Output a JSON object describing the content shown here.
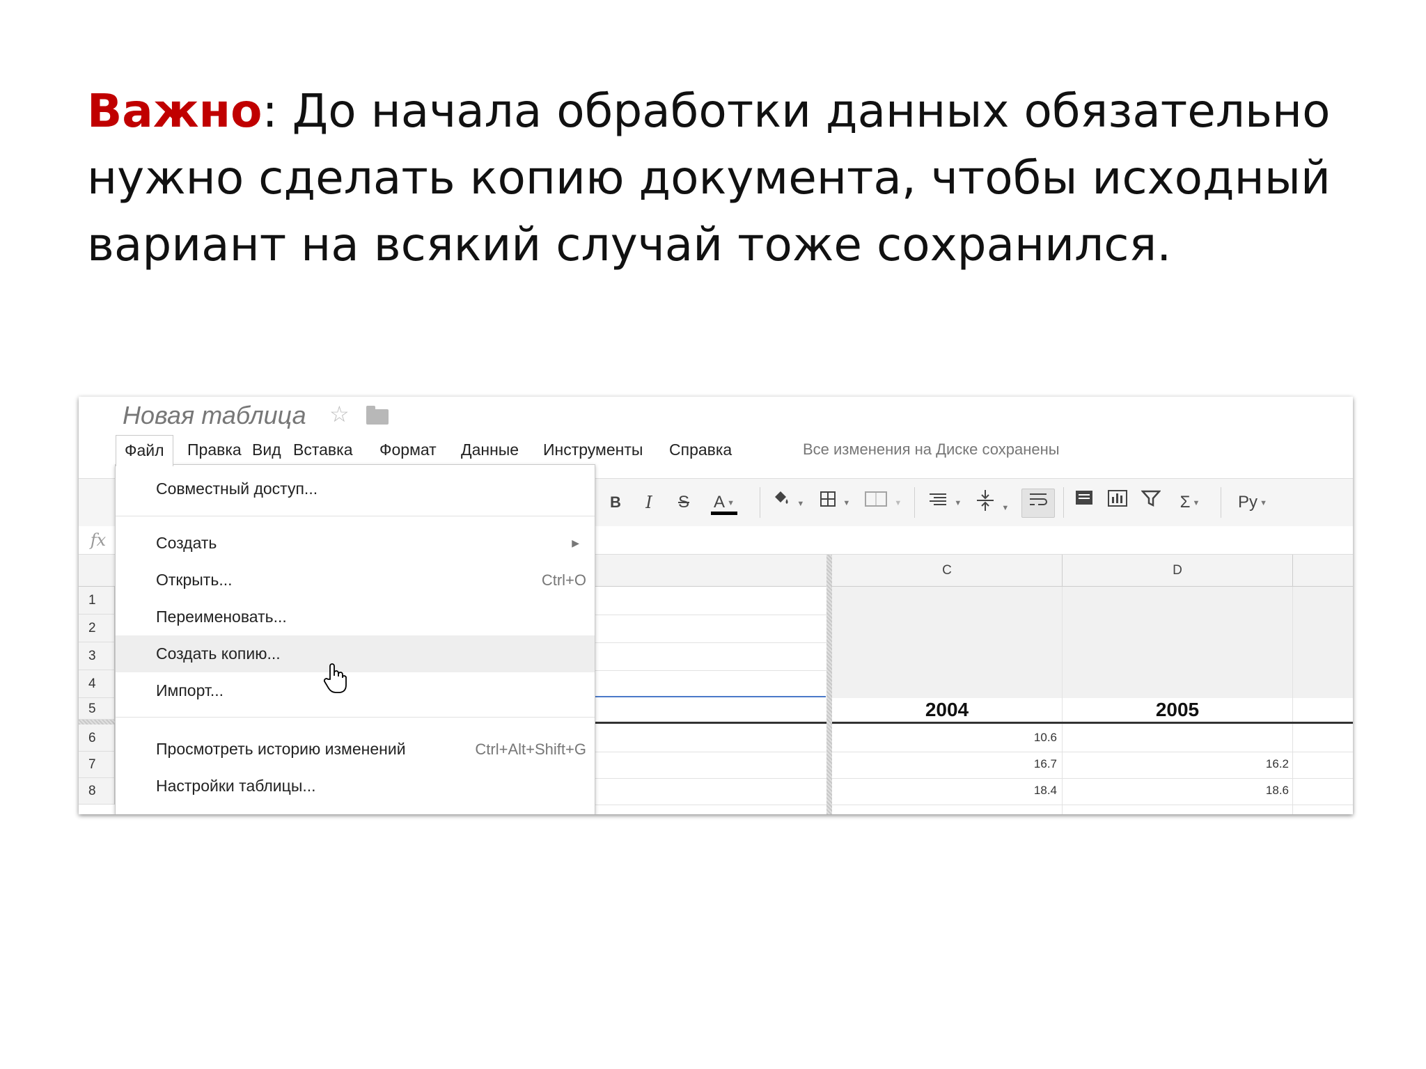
{
  "slide": {
    "heading_highlight": "Важно",
    "heading_rest": ": До начала обработки данных обязательно нужно сделать копию документа, чтобы исходный вариант на всякий случай тоже сохранился."
  },
  "app": {
    "doc_title": "Новая таблица",
    "menu": [
      "Файл",
      "Правка",
      "Вид",
      "Вставка",
      "Формат",
      "Данные",
      "Инструменты",
      "Справка"
    ],
    "save_status": "Все изменения на Диске сохранены",
    "toolbar": {
      "bold": "B",
      "italic": "I",
      "strike": "S",
      "text_color": "A",
      "font_label": "Ру",
      "sum": "Σ"
    },
    "file_menu": {
      "share": "Совместный доступ...",
      "create": "Создать",
      "open": "Открыть...",
      "open_shortcut": "Ctrl+O",
      "rename": "Переименовать...",
      "make_copy": "Создать копию...",
      "import": "Импорт...",
      "history": "Просмотреть историю изменений",
      "history_shortcut": "Ctrl+Alt+Shift+G",
      "settings": "Настройки таблицы..."
    },
    "sheet": {
      "columns": [
        "C",
        "D"
      ],
      "rows": [
        "1",
        "2",
        "3",
        "4",
        "5",
        "6",
        "7",
        "8"
      ],
      "years": [
        "2004",
        "2005"
      ],
      "row6": [
        "10.6",
        ""
      ],
      "row7": [
        "16.7",
        "16.2"
      ],
      "row8": [
        "18.4",
        "18.6"
      ]
    }
  },
  "colors": {
    "highlight": "#c00000",
    "accent_line": "#4a79c8"
  }
}
